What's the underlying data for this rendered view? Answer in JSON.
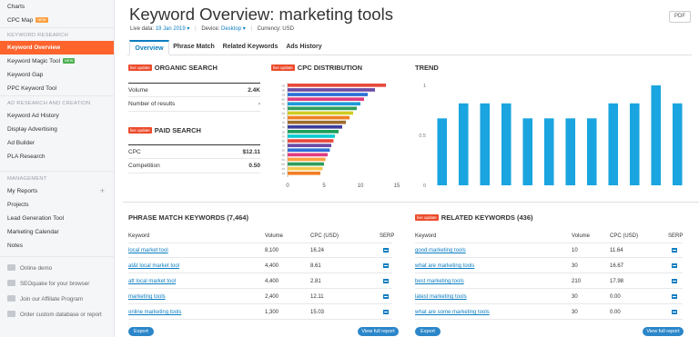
{
  "sidebar": {
    "charts": "Charts",
    "cpc_map": "CPC Map",
    "cpc_map_badge": "NEW",
    "section_keyword_research": "KEYWORD RESEARCH",
    "keyword_overview": "Keyword Overview",
    "keyword_magic_tool": "Keyword Magic Tool",
    "keyword_magic_badge": "NEW",
    "keyword_gap": "Keyword Gap",
    "ppc_keyword_tool": "PPC Keyword Tool",
    "section_ad_research": "AD RESEARCH AND CREATION",
    "keyword_ad_history": "Keyword Ad History",
    "display_advertising": "Display Advertising",
    "ad_builder": "Ad Builder",
    "pla_research": "PLA Research",
    "section_management": "MANAGEMENT",
    "my_reports": "My Reports",
    "projects": "Projects",
    "lead_generation_tool": "Lead Generation Tool",
    "marketing_calendar": "Marketing Calendar",
    "notes": "Notes",
    "online_demo": "Online demo",
    "seoquake": "SEOquake for your browser",
    "affiliate": "Join our Affiliate Program",
    "order_custom": "Order custom database or report"
  },
  "header": {
    "title_prefix": "Keyword Overview:",
    "title_keyword": "marketing tools",
    "pdf_label": "PDF",
    "live_data_label": "Live data:",
    "live_data_value": "19 Jan 2019",
    "device_label": "Device:",
    "device_value": "Desktop",
    "currency_label": "Currency: USD"
  },
  "tabs": [
    "Overview",
    "Phrase Match",
    "Related Keywords",
    "Ads History"
  ],
  "live_badge": "live update",
  "organic": {
    "title": "ORGANIC SEARCH",
    "volume_label": "Volume",
    "volume_value": "2.4K",
    "results_label": "Number of results",
    "results_value": "-"
  },
  "paid": {
    "title": "PAID SEARCH",
    "cpc_label": "CPC",
    "cpc_value": "$12.11",
    "competition_label": "Competition",
    "competition_value": "0.50"
  },
  "cpc_distribution": {
    "title": "CPC DISTRIBUTION",
    "countries": [
      "us",
      "uk",
      "ca",
      "au",
      "de",
      "fr",
      "es",
      "it",
      "br",
      "ru",
      "jp",
      "in",
      "hk",
      "nl",
      "se",
      "dk",
      "no",
      "be",
      "ch",
      "za"
    ],
    "values": [
      13.5,
      12.0,
      11.0,
      10.5,
      10.0,
      9.5,
      9.0,
      8.5,
      8.0,
      7.5,
      7.0,
      6.5,
      6.3,
      6.0,
      5.8,
      5.5,
      5.2,
      5.0,
      4.8,
      4.5
    ],
    "colors": [
      "#e8493d",
      "#6b4ca5",
      "#2f6fd6",
      "#e03d80",
      "#1f9bd7",
      "#2f9e5a",
      "#cfcc23",
      "#f07f23",
      "#9d6b2a",
      "#3d3d9c",
      "#1ca05a",
      "#0dcbd0",
      "#e8493d",
      "#6b4ca5",
      "#2f6fd6",
      "#e03d80",
      "#ff9f40",
      "#2f9e5a",
      "#f5c84b",
      "#f07f23"
    ],
    "xticks": [
      0,
      5,
      10,
      15
    ],
    "xlim": [
      0,
      15
    ]
  },
  "trend": {
    "title": "TREND",
    "yticks": [
      "1",
      "0.5",
      "0"
    ],
    "values": [
      0.67,
      0.82,
      0.82,
      0.82,
      0.67,
      0.67,
      0.67,
      0.67,
      0.82,
      0.82,
      1.0,
      0.82
    ],
    "color": "#1aa5e0"
  },
  "phrase_match": {
    "title": "PHRASE MATCH KEYWORDS (7,464)",
    "columns": [
      "Keyword",
      "Volume",
      "CPC (USD)",
      "SERP"
    ],
    "rows": [
      {
        "keyword": "local market tool",
        "volume": "8,100",
        "cpc": "16.24"
      },
      {
        "keyword": "at&t local market tool",
        "volume": "4,400",
        "cpc": "8.61"
      },
      {
        "keyword": "att local market tool",
        "volume": "4,400",
        "cpc": "2.81"
      },
      {
        "keyword": "marketing tools",
        "volume": "2,400",
        "cpc": "12.11"
      },
      {
        "keyword": "online marketing tools",
        "volume": "1,300",
        "cpc": "15.03"
      }
    ],
    "export_label": "Export",
    "view_full_label": "View full report"
  },
  "related": {
    "title": "RELATED KEYWORDS (436)",
    "columns": [
      "Keyword",
      "Volume",
      "CPC (USD)",
      "SERP"
    ],
    "rows": [
      {
        "keyword": "good marketing tools",
        "volume": "10",
        "cpc": "11.64"
      },
      {
        "keyword": "what are marketing tools",
        "volume": "30",
        "cpc": "16.67"
      },
      {
        "keyword": "best marketing tools",
        "volume": "210",
        "cpc": "17.98"
      },
      {
        "keyword": "latest marketing tools",
        "volume": "30",
        "cpc": "0.00"
      },
      {
        "keyword": "what are some marketing tools",
        "volume": "30",
        "cpc": "0.00"
      }
    ],
    "export_label": "Export",
    "view_full_label": "View full report"
  }
}
